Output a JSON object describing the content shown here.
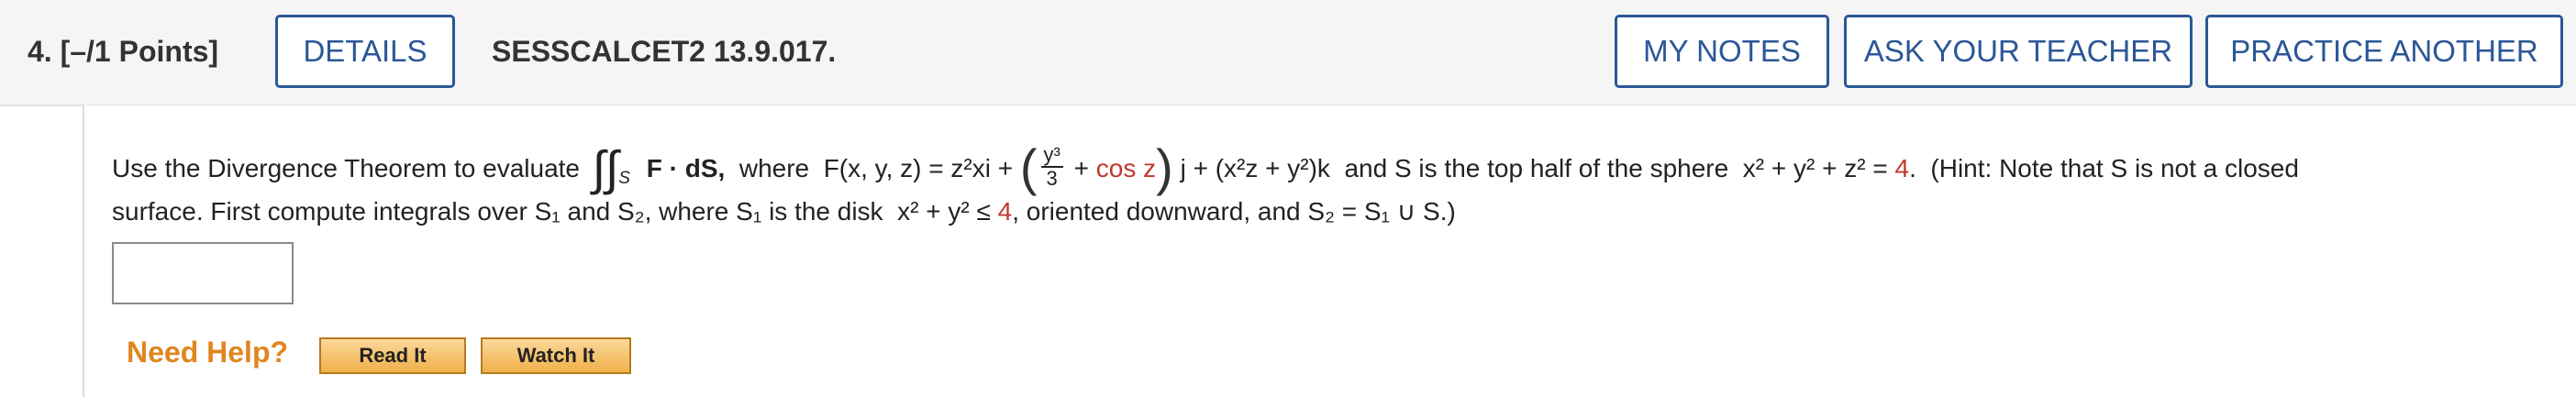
{
  "header": {
    "question_number": "4.",
    "points": "[–/1 Points]",
    "details_label": "DETAILS",
    "question_id": "SESSCALCET2 13.9.017.",
    "my_notes_label": "MY NOTES",
    "ask_teacher_label": "ASK YOUR TEACHER",
    "practice_label": "PRACTICE ANOTHER"
  },
  "problem": {
    "intro": "Use the Divergence Theorem to evaluate",
    "integrand": "F · dS,",
    "where1": "where",
    "field_lhs": "F(x, y, z) =",
    "term1": "z²xi +",
    "frac_num": "y³",
    "frac_den": "3",
    "plus": "+",
    "cos_term": "cos z",
    "term2": "j + (x²z + y²)k",
    "surface_desc": "and S is the top half of the sphere",
    "sphere_eq": "x² + y² + z² =",
    "radius_sq": "4",
    "hint": "(Hint: Note that S is not a closed",
    "line2_a": "surface. First compute integrals over S₁ and S₂, where S₁ is the disk",
    "disk_eq": "x² + y² ≤",
    "disk_val": "4",
    "line2_b": ", oriented downward, and S₂ = S₁ ∪ S.)"
  },
  "answer": {
    "value": ""
  },
  "help": {
    "label": "Need Help?",
    "read_label": "Read It",
    "watch_label": "Watch It"
  }
}
